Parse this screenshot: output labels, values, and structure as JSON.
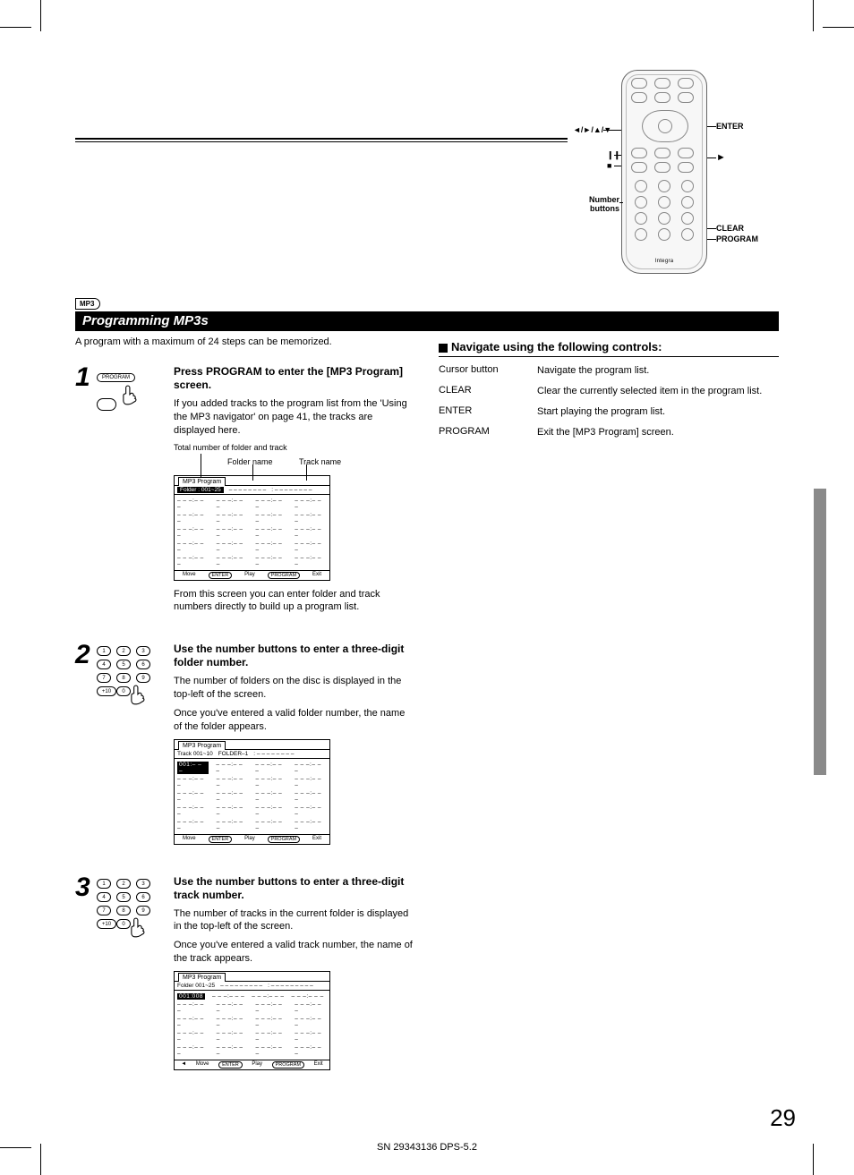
{
  "badge": "MP3",
  "section_title": "Programming MP3s",
  "intro": "A program with a maximum of 24 steps can be memorized.",
  "remote": {
    "arrows": "◄/►/▲/▼",
    "pause": "❙❙",
    "stop": "■",
    "enter": "ENTER",
    "play": "►",
    "number": "Number buttons",
    "clear": "CLEAR",
    "program": "PROGRAM",
    "brand": "Integra"
  },
  "right": {
    "heading": "Navigate using the following controls:",
    "rows": [
      {
        "k": "Cursor button",
        "v": "Navigate the program list."
      },
      {
        "k": "CLEAR",
        "v": "Clear the currently selected item in the program list."
      },
      {
        "k": "ENTER",
        "v": "Start playing the program list."
      },
      {
        "k": "PROGRAM",
        "v": "Exit the [MP3 Program] screen."
      }
    ]
  },
  "steps": {
    "s1": {
      "num": "1",
      "icon_label": "PROGRAM",
      "title": "Press PROGRAM to enter the [MP3 Program] screen.",
      "p1": "If you added tracks to the program list from the 'Using the MP3 navigator' on page 41, the tracks are displayed here.",
      "annot_total": "Total number of folder and track",
      "annot_folder": "Folder name",
      "annot_track": "Track name",
      "osd": {
        "tab": "MP3 Program",
        "hdr_boxed": "Folder : 001~25",
        "hdr_mid": "– – – – – – – –",
        "hdr_right": ": – – – – – – – –",
        "cell": "– – –:– – –",
        "ftr_move": "Move",
        "ftr_enter": "ENTER",
        "ftr_play": "Play",
        "ftr_program": "PROGRAM",
        "ftr_exit": "Exit"
      },
      "p2": "From this screen you can enter folder and track numbers directly to build up a program list."
    },
    "s2": {
      "num": "2",
      "title": "Use the number buttons to enter a three-digit folder number.",
      "p1": "The number of folders on the disc is displayed in the top-left of the screen.",
      "p2": "Once you've entered a valid folder number, the name of the folder appears.",
      "osd": {
        "tab": "MP3 Program",
        "hdr_left": "Track    001~10",
        "hdr_mid": "FOLDER–1",
        "hdr_right": ": – – – – – – – –",
        "sel": "001:– – –",
        "cell": "– – –:– – –",
        "ftr_move": "Move",
        "ftr_enter": "ENTER",
        "ftr_play": "Play",
        "ftr_program": "PROGRAM",
        "ftr_exit": "Exit"
      }
    },
    "s3": {
      "num": "3",
      "title": "Use the number buttons to enter a three-digit track number.",
      "p1": "The number of tracks in the current folder is displayed in the top-left of the screen.",
      "p2": "Once you've entered a valid track number, the name of the track appears.",
      "osd": {
        "tab": "MP3 Program",
        "hdr_left": "Folder   001~25",
        "hdr_mid": "– – – – – – – – –",
        "hdr_right": ": – – – – – – – – –",
        "sel": "001:008",
        "cell": "– – –:– – –",
        "ftr_move": "Move",
        "ftr_enter": "ENTER",
        "ftr_play": "Play",
        "ftr_program": "PROGRAM",
        "ftr_exit": "Exit"
      }
    }
  },
  "page_number": "29",
  "footer": "SN 29343136 DPS-5.2"
}
